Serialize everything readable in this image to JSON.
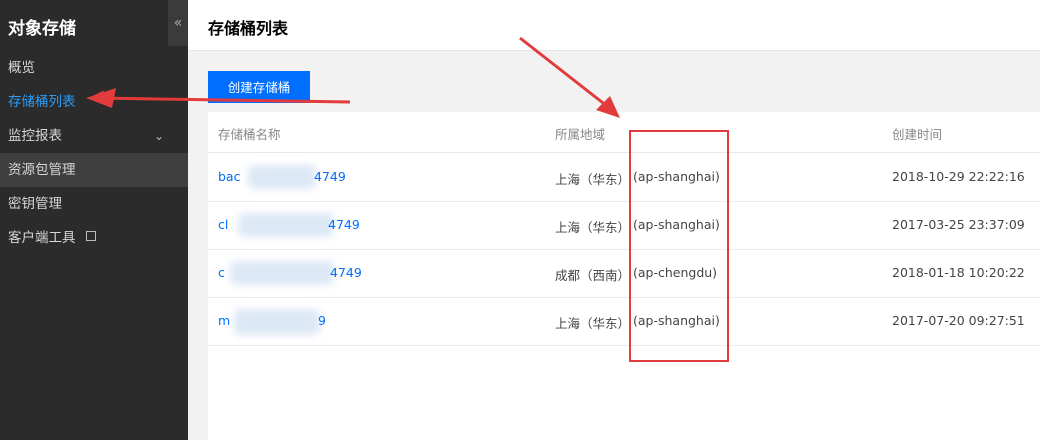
{
  "sidebar": {
    "title": "对象存储",
    "collapse_glyph": "«",
    "items": [
      {
        "label": "概览"
      },
      {
        "label": "存储桶列表"
      },
      {
        "label": "监控报表",
        "chevron": "⌄"
      },
      {
        "label": "资源包管理"
      },
      {
        "label": "密钥管理"
      },
      {
        "label": "客户端工具"
      }
    ]
  },
  "header": {
    "title": "存储桶列表"
  },
  "toolbar": {
    "create_label": "创建存储桶"
  },
  "table": {
    "columns": [
      "存储桶名称",
      "所属地域",
      "创建时间"
    ],
    "rows": [
      {
        "name_prefix": "bac",
        "name_suffix": "4749",
        "region_name": "上海（华东）",
        "region_code": "(ap-shanghai)",
        "created": "2018-10-29 22:22:16"
      },
      {
        "name_prefix": "cl",
        "name_suffix": "4749",
        "region_name": "上海（华东）",
        "region_code": "(ap-shanghai)",
        "created": "2017-03-25 23:37:09"
      },
      {
        "name_prefix": "c",
        "name_suffix": "4749",
        "region_name": "成都（西南）",
        "region_code": "(ap-chengdu)",
        "created": "2018-01-18 10:20:22"
      },
      {
        "name_prefix": "m",
        "name_suffix": "9",
        "region_name": "上海（华东）",
        "region_code": "(ap-shanghai)",
        "created": "2017-07-20 09:27:51"
      }
    ]
  },
  "colors": {
    "accent": "#006eff",
    "sidebar_bg": "#2b2b2b",
    "annotation": "#e23b3b"
  }
}
